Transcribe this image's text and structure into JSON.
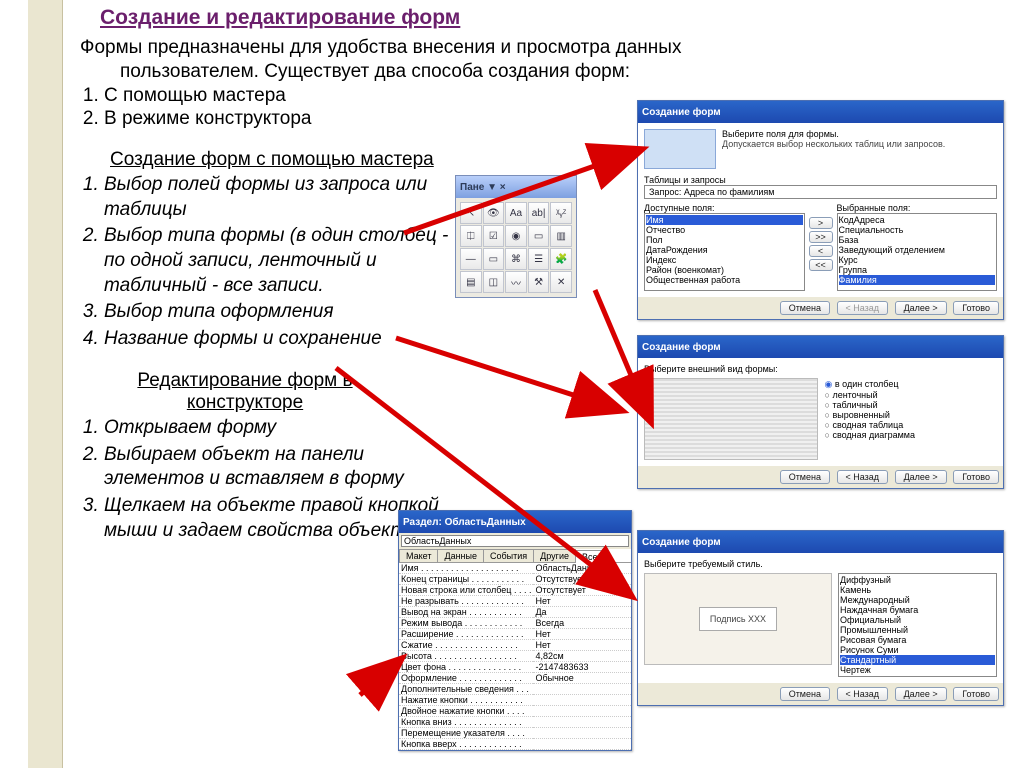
{
  "title": "Создание и редактирование форм",
  "intro_line1": "Формы предназначены для удобства внесения и просмотра данных",
  "intro_line2": "пользователем. Существует два способа создания форм:",
  "intro_items": [
    "С помощью мастера",
    "В режиме конструктора"
  ],
  "wizard_h": "Создание форм с помощью мастера",
  "wizard_steps": [
    "Выбор полей формы из запроса или таблицы",
    "Выбор типа формы (в один столбец - по одной записи, ленточный и табличный - все записи.",
    "Выбор типа оформления",
    "Название формы и сохранение"
  ],
  "designer_h": "Редактирование форм в конструкторе",
  "designer_steps": [
    "Открываем форму",
    "Выбираем объект на панели элементов и вставляем в форму",
    "Щелкаем на объекте правой кнопкой мыши и задаем свойства объекта"
  ],
  "toolbox_title": "Пане ▼ ×",
  "toolbox_icons": [
    "↖",
    "👁",
    "Aa",
    "ab|",
    "ᵡᵧᶻ",
    "⎅",
    "☑",
    "◉",
    "▭",
    "▥",
    "—",
    "▭",
    "⌘",
    "☰",
    "🧩",
    "▤",
    "◫",
    "〰",
    "⚒",
    "✕"
  ],
  "wiz1": {
    "title": "Создание форм",
    "hint1": "Выберите поля для формы.",
    "hint2": "Допускается выбор нескольких таблиц или запросов.",
    "tables_label": "Таблицы и запросы",
    "tables_value": "Запрос: Адреса по фамилиям",
    "avail_label": "Доступные поля:",
    "sel_label": "Выбранные поля:",
    "avail": [
      "Имя",
      "Отчество",
      "Пол",
      "ДатаРождения",
      "Индекс",
      "Район (военкомат)",
      "Общественная работа"
    ],
    "sel": [
      "КодАдреса",
      "Специальность",
      "База",
      "Заведующий отделением",
      "Курс",
      "Группа",
      "Фамилия"
    ],
    "btns": {
      "cancel": "Отмена",
      "back": "< Назад",
      "next": "Далее >",
      "done": "Готово"
    }
  },
  "wiz2": {
    "title": "Создание форм",
    "hint": "Выберите внешний вид формы:",
    "layouts": [
      "в один столбец",
      "ленточный",
      "табличный",
      "выровненный",
      "сводная таблица",
      "сводная диаграмма"
    ],
    "btns": {
      "cancel": "Отмена",
      "back": "< Назад",
      "next": "Далее >",
      "done": "Готово"
    }
  },
  "wiz3": {
    "title": "Создание форм",
    "hint": "Выберите требуемый стиль.",
    "styles": [
      "Диффузный",
      "Камень",
      "Международный",
      "Наждачная бумага",
      "Официальный",
      "Промышленный",
      "Рисовая бумага",
      "Рисунок Суми",
      "Стандартный",
      "Чертеж"
    ],
    "preview_label": "Подпись   XXX",
    "btns": {
      "cancel": "Отмена",
      "back": "< Назад",
      "next": "Далее >",
      "done": "Готово"
    }
  },
  "props": {
    "title": "Раздел: ОбластьДанных",
    "combo": "ОбластьДанных",
    "tabs": [
      "Макет",
      "Данные",
      "События",
      "Другие",
      "Все"
    ],
    "rows": [
      [
        "Имя . . . . . . . . . . . . . . . . . . . .",
        "ОбластьДанных"
      ],
      [
        "Конец страницы . . . . . . . . . . .",
        "Отсутствует"
      ],
      [
        "Новая строка или столбец . . . .",
        "Отсутствует"
      ],
      [
        "Не разрывать . . . . . . . . . . . . .",
        "Нет"
      ],
      [
        "Вывод на экран . . . . . . . . . . .",
        "Да"
      ],
      [
        "Режим вывода . . . . . . . . . . . .",
        "Всегда"
      ],
      [
        "Расширение . . . . . . . . . . . . . .",
        "Нет"
      ],
      [
        "Сжатие . . . . . . . . . . . . . . . . .",
        "Нет"
      ],
      [
        "Высота . . . . . . . . . . . . . . . . .",
        "4,82см"
      ],
      [
        "Цвет фона . . . . . . . . . . . . . . .",
        "-2147483633"
      ],
      [
        "Оформление . . . . . . . . . . . . .",
        "Обычное"
      ],
      [
        "Дополнительные сведения . . .",
        ""
      ],
      [
        "Нажатие кнопки . . . . . . . . . . .",
        ""
      ],
      [
        "Двойное нажатие кнопки . . . .",
        ""
      ],
      [
        "Кнопка вниз . . . . . . . . . . . . . .",
        ""
      ],
      [
        "Перемещение указателя . . . .",
        ""
      ],
      [
        "Кнопка вверх . . . . . . . . . . . . .",
        ""
      ]
    ]
  }
}
